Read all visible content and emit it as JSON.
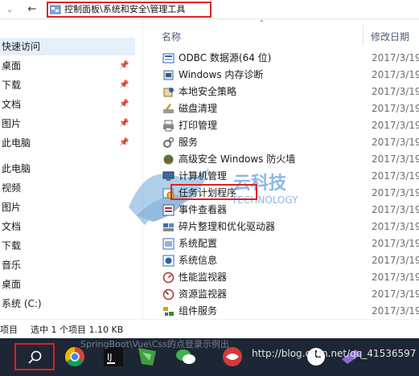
{
  "address_bar": {
    "breadcrumb": "控制面板\\系统和安全\\管理工具",
    "back_glyph": "←",
    "dropdown_glyph": "⌄"
  },
  "nav_pane": {
    "quick_access_label": "快速访问",
    "quick_items": [
      {
        "label": "桌面"
      },
      {
        "label": "下载"
      },
      {
        "label": "文档"
      },
      {
        "label": "图片"
      },
      {
        "label": "此电脑"
      }
    ],
    "this_pc_label": "此电脑",
    "pc_items": [
      {
        "label": "视频"
      },
      {
        "label": "图片"
      },
      {
        "label": "文档"
      },
      {
        "label": "下载"
      },
      {
        "label": "音乐"
      },
      {
        "label": "桌面"
      },
      {
        "label": "系统 (C:)"
      }
    ]
  },
  "columns": {
    "name": "名称",
    "date": "修改日期"
  },
  "files": [
    {
      "name": "ODBC 数据源(64 位)",
      "date": "2017/3/19",
      "icon": "odbc-icon"
    },
    {
      "name": "Windows 内存诊断",
      "date": "2017/3/19",
      "icon": "memory-diagnostic-icon"
    },
    {
      "name": "本地安全策略",
      "date": "2017/3/19",
      "icon": "security-policy-icon"
    },
    {
      "name": "磁盘清理",
      "date": "2017/3/19",
      "icon": "disk-cleanup-icon"
    },
    {
      "name": "打印管理",
      "date": "2017/3/19",
      "icon": "printer-icon"
    },
    {
      "name": "服务",
      "date": "2017/3/19",
      "icon": "services-icon"
    },
    {
      "name": "高级安全 Windows 防火墙",
      "date": "2017/3/19",
      "icon": "firewall-icon"
    },
    {
      "name": "计算机管理",
      "date": "2017/3/19",
      "icon": "computer-management-icon"
    },
    {
      "name": "任务计划程序",
      "date": "2017/3/19",
      "icon": "task-scheduler-icon"
    },
    {
      "name": "事件查看器",
      "date": "2017/3/19",
      "icon": "event-viewer-icon"
    },
    {
      "name": "碎片整理和优化驱动器",
      "date": "2017/3/19",
      "icon": "defrag-icon"
    },
    {
      "name": "系统配置",
      "date": "2017/3/19",
      "icon": "system-config-icon"
    },
    {
      "name": "系统信息",
      "date": "2017/3/19",
      "icon": "system-info-icon"
    },
    {
      "name": "性能监视器",
      "date": "2017/3/19",
      "icon": "performance-monitor-icon"
    },
    {
      "name": "资源监视器",
      "date": "2017/3/19",
      "icon": "resource-monitor-icon"
    },
    {
      "name": "组件服务",
      "date": "2017/3/19",
      "icon": "component-services-icon"
    }
  ],
  "status_bar": {
    "count_text": "项目",
    "selection_text": "选中 1 个项目  1.10 KB"
  },
  "ghost_text": "SpringBoot\\Vue\\Css的点登录示例出",
  "watermark": {
    "main": "云科技",
    "sub": "TECHNOLOGY"
  },
  "taskbar": {
    "url_text": "http://blog.csdn.net/qq_41536597"
  },
  "colors": {
    "accent_red": "#e02020",
    "taskbar_bg": "#1d2634",
    "selection_bg": "#e5f0fb"
  }
}
